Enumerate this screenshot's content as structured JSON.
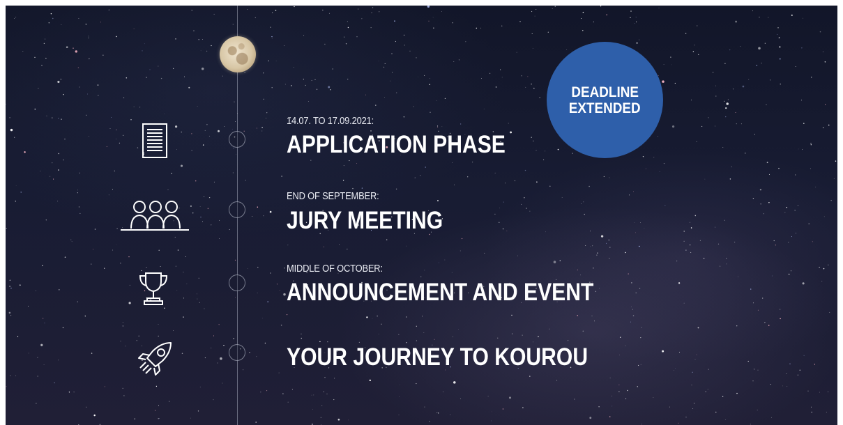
{
  "badge": {
    "line1": "DEADLINE",
    "line2": "EXTENDED",
    "color": "#2e5faa"
  },
  "timeline": {
    "steps": [
      {
        "date": "14.07. TO 17.09.2021:",
        "title": "APPLICATION PHASE",
        "icon": "document-icon"
      },
      {
        "date": "END OF SEPTEMBER:",
        "title": "JURY MEETING",
        "icon": "jury-group-icon"
      },
      {
        "date": "MIDDLE OF OCTOBER:",
        "title": "ANNOUNCEMENT AND EVENT",
        "icon": "trophy-icon"
      },
      {
        "date": "",
        "title": "YOUR JOURNEY TO KOUROU",
        "icon": "rocket-icon"
      }
    ]
  }
}
